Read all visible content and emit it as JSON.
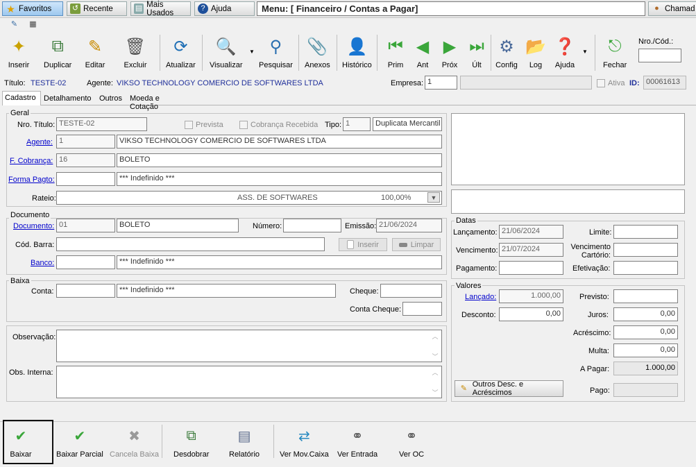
{
  "top": {
    "favoritos": "Favoritos",
    "recente": "Recente",
    "mais_usados": "Mais Usados",
    "ajuda": "Ajuda",
    "menu_title": "Menu: [ Financeiro / Contas a Pagar]",
    "chamado": "Chamad"
  },
  "toolbar": {
    "inserir": "Inserir",
    "duplicar": "Duplicar",
    "editar": "Editar",
    "excluir": "Excluir",
    "atualizar": "Atualizar",
    "visualizar": "Visualizar",
    "pesquisar": "Pesquisar",
    "anexos": "Anexos",
    "historico": "Histórico",
    "prim": "Prim",
    "ant": "Ant",
    "prox": "Próx",
    "ult": "Últ",
    "config": "Config",
    "log": "Log",
    "ajuda": "Ajuda",
    "fechar": "Fechar",
    "nro_cod_label": "Nro./Cód.:",
    "nro_cod_value": ""
  },
  "header": {
    "titulo_label": "Título:",
    "titulo_value": "TESTE-02",
    "agente_label": "Agente:",
    "agente_value": "VIKSO TECHNOLOGY COMERCIO DE SOFTWARES LTDA",
    "empresa_label": "Empresa:",
    "empresa_value": "1",
    "empresa_name": "",
    "ativa_label": "Ativa",
    "id_label": "ID:",
    "id_value": "00061613"
  },
  "tabs": [
    "Cadastro",
    "Detalhamento",
    "Outros",
    "Moeda e Cotação"
  ],
  "geral": {
    "title": "Geral",
    "nro_titulo_label": "Nro. Título:",
    "nro_titulo_value": "TESTE-02",
    "prevista_label": "Prevista",
    "cobranca_recebida_label": "Cobrança Recebida",
    "tipo_label": "Tipo:",
    "tipo_code": "1",
    "tipo_name": "Duplicata Mercantil",
    "agente_label": "Agente:",
    "agente_code": "1",
    "agente_name": "VIKSO TECHNOLOGY COMERCIO DE SOFTWARES LTDA",
    "fcobranca_label": "F. Cobrança:",
    "fcobranca_code": "16",
    "fcobranca_name": "BOLETO",
    "forma_pagto_label": "Forma Pagto:",
    "forma_pagto_code": "",
    "forma_pagto_name": "*** Indefinido ***",
    "rateio_label": "Rateio:",
    "rateio_desc": "ASS. DE SOFTWARES",
    "rateio_pct": "100,00%"
  },
  "documento": {
    "title": "Documento",
    "documento_label": "Documento:",
    "documento_code": "01",
    "documento_name": "BOLETO",
    "numero_label": "Número:",
    "numero_value": "",
    "emissao_label": "Emissão:",
    "emissao_value": "21/06/2024",
    "cod_barra_label": "Cód. Barra:",
    "cod_barra_value": "",
    "inserir_label": "Inserir",
    "limpar_label": "Limpar",
    "banco_label": "Banco:",
    "banco_code": "",
    "banco_name": "*** Indefinido ***"
  },
  "baixa": {
    "title": "Baixa",
    "conta_label": "Conta:",
    "conta_code": "",
    "conta_name": "*** Indefinido ***",
    "cheque_label": "Cheque:",
    "cheque_value": "",
    "conta_cheque_label": "Conta Cheque:",
    "conta_cheque_value": ""
  },
  "obs": {
    "observacao_label": "Observação:",
    "observacao_value": "",
    "interna_label": "Obs. Interna:",
    "interna_value": ""
  },
  "datas": {
    "title": "Datas",
    "lancamento_label": "Lançamento:",
    "lancamento_value": "21/06/2024",
    "limite_label": "Limite:",
    "limite_value": "",
    "vencimento_label": "Vencimento:",
    "vencimento_value": "21/07/2024",
    "venc_cartorio_label1": "Vencimento",
    "venc_cartorio_label2": "Cartório:",
    "venc_cartorio_value": "",
    "pagamento_label": "Pagamento:",
    "pagamento_value": "",
    "efetivacao_label": "Efetivação:",
    "efetivacao_value": ""
  },
  "valores": {
    "title": "Valores",
    "lancado_label": "Lançado:",
    "lancado_value": "1.000,00",
    "previsto_label": "Previsto:",
    "previsto_value": "",
    "desconto_label": "Desconto:",
    "desconto_value": "0,00",
    "juros_label": "Juros:",
    "juros_value": "0,00",
    "acrescimo_label": "Acréscimo:",
    "acrescimo_value": "0,00",
    "multa_label": "Multa:",
    "multa_value": "0,00",
    "a_pagar_label": "A Pagar:",
    "a_pagar_value": "1.000,00",
    "outros_button": "Outros Desc. e Acréscimos",
    "pago_label": "Pago:",
    "pago_value": ""
  },
  "bottom": {
    "baixar": "Baixar",
    "baixar_parcial": "Baixar Parcial",
    "cancela_baixa": "Cancela Baixa",
    "desdobrar": "Desdobrar",
    "relatorio": "Relatório",
    "ver_mov_caixa": "Ver Mov.Caixa",
    "ver_entrada": "Ver Entrada",
    "ver_oc": "Ver OC"
  }
}
